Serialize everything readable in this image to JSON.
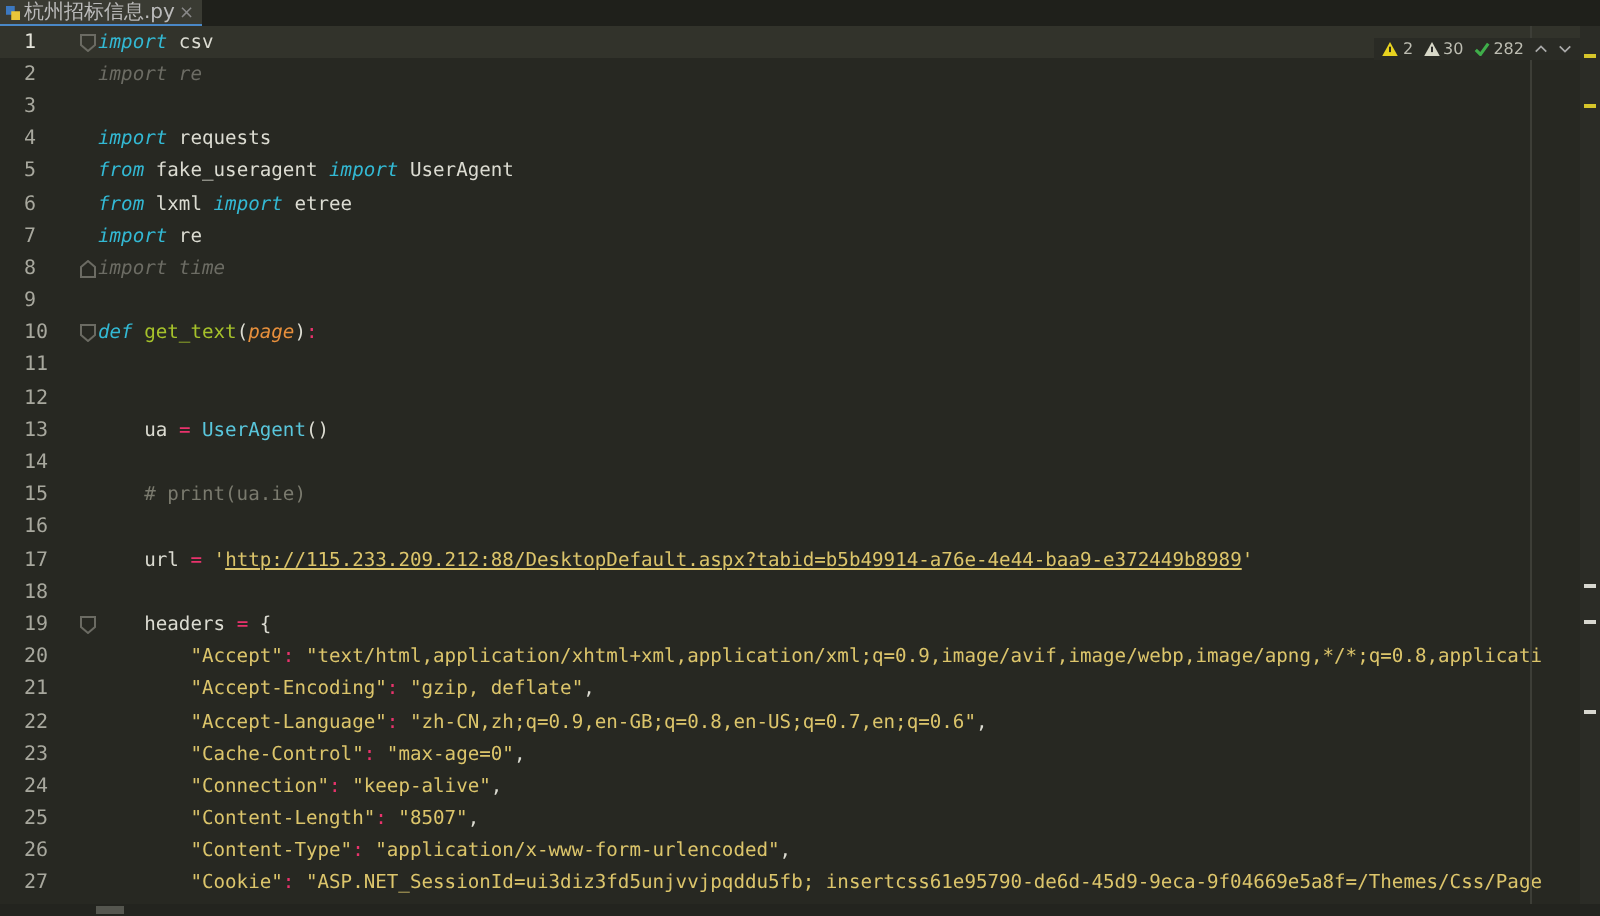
{
  "tab": {
    "title": "杭州招标信息.py",
    "close": "×",
    "selected": true
  },
  "inspections": [
    {
      "kind": "error",
      "count": "2"
    },
    {
      "kind": "warning",
      "count": "30"
    },
    {
      "kind": "typo",
      "count": "282"
    }
  ],
  "lines": [
    {
      "number": "1",
      "current": true,
      "kind": "fold-start",
      "tokens": [
        {
          "kind": "kw",
          "text": "import"
        },
        {
          "kind": "plain",
          "text": " csv"
        }
      ]
    },
    {
      "number": "2",
      "current": false,
      "kind": "code",
      "tokens": [
        {
          "kind": "dim",
          "text": "import re"
        }
      ]
    },
    {
      "number": "3",
      "current": false,
      "kind": "code"
    },
    {
      "number": "4",
      "current": false,
      "kind": "code",
      "tokens": [
        {
          "kind": "kw",
          "text": "import"
        },
        {
          "kind": "plain",
          "text": " requests"
        }
      ]
    },
    {
      "number": "5",
      "current": false,
      "kind": "code",
      "tokens": [
        {
          "kind": "kw",
          "text": "from"
        },
        {
          "kind": "plain",
          "text": " fake_useragent "
        },
        {
          "kind": "kw",
          "text": "import"
        },
        {
          "kind": "plain",
          "text": " UserAgent"
        }
      ]
    },
    {
      "number": "6",
      "current": false,
      "kind": "code",
      "tokens": [
        {
          "kind": "kw",
          "text": "from"
        },
        {
          "kind": "plain",
          "text": " lxml "
        },
        {
          "kind": "kw",
          "text": "import"
        },
        {
          "kind": "plain",
          "text": " etree"
        }
      ]
    },
    {
      "number": "7",
      "current": false,
      "kind": "code",
      "tokens": [
        {
          "kind": "kw",
          "text": "import"
        },
        {
          "kind": "plain",
          "text": " re"
        }
      ]
    },
    {
      "number": "8",
      "current": false,
      "kind": "fold-end",
      "tokens": [
        {
          "kind": "dim",
          "text": "import time"
        }
      ]
    },
    {
      "number": "9",
      "current": false,
      "kind": "code"
    },
    {
      "number": "10",
      "current": false,
      "kind": "fold-start",
      "tokens": [
        {
          "kind": "kw",
          "text": "def"
        },
        {
          "kind": "fn",
          "text": " get_text"
        },
        {
          "kind": "plain",
          "text": "("
        },
        {
          "kind": "param",
          "text": "page"
        },
        {
          "kind": "plain",
          "text": ")"
        },
        {
          "kind": "op",
          "text": ":"
        }
      ]
    },
    {
      "number": "11",
      "current": false,
      "kind": "code"
    },
    {
      "number": "12",
      "current": false,
      "kind": "code"
    },
    {
      "number": "13",
      "current": false,
      "kind": "code",
      "tokens": [
        {
          "kind": "plain",
          "text": "    ua "
        },
        {
          "kind": "op",
          "text": "="
        },
        {
          "kind": "cls",
          "text": " UserAgent"
        },
        {
          "kind": "plain",
          "text": "()"
        }
      ]
    },
    {
      "number": "14",
      "current": false,
      "kind": "code"
    },
    {
      "number": "15",
      "current": false,
      "kind": "code",
      "tokens": [
        {
          "kind": "comment",
          "text": "    # print(ua.ie)"
        }
      ]
    },
    {
      "number": "16",
      "current": false,
      "kind": "code"
    },
    {
      "number": "17",
      "current": false,
      "kind": "code",
      "tokens": [
        {
          "kind": "plain",
          "text": "    url "
        },
        {
          "kind": "op",
          "text": "="
        },
        {
          "kind": "str",
          "text": " '"
        },
        {
          "kind": "url",
          "text": "http://115.233.209.212:88/DesktopDefault.aspx?tabid=b5b49914-a76e-4e44-baa9-e372449b8989"
        },
        {
          "kind": "str",
          "text": "'"
        }
      ]
    },
    {
      "number": "18",
      "current": false,
      "kind": "code"
    },
    {
      "number": "19",
      "current": false,
      "kind": "fold-start",
      "tokens": [
        {
          "kind": "plain",
          "text": "    headers "
        },
        {
          "kind": "op",
          "text": "="
        },
        {
          "kind": "plain",
          "text": " {"
        }
      ]
    },
    {
      "number": "20",
      "current": false,
      "kind": "code",
      "tokens": [
        {
          "kind": "str",
          "text": "        \"Accept\""
        },
        {
          "kind": "op",
          "text": ":"
        },
        {
          "kind": "str",
          "text": " \"text/html,application/xhtml+xml,application/xml;q=0.9,image/avif,image/webp,image/apng,*/*;q=0.8,applicati"
        }
      ]
    },
    {
      "number": "21",
      "current": false,
      "kind": "code",
      "tokens": [
        {
          "kind": "str",
          "text": "        \"Accept-Encoding\""
        },
        {
          "kind": "op",
          "text": ":"
        },
        {
          "kind": "str",
          "text": " \"gzip, deflate\""
        },
        {
          "kind": "plain",
          "text": ","
        }
      ]
    },
    {
      "number": "22",
      "current": false,
      "kind": "code",
      "tokens": [
        {
          "kind": "str",
          "text": "        \"Accept-Language\""
        },
        {
          "kind": "op",
          "text": ":"
        },
        {
          "kind": "str",
          "text": " \"zh-CN,zh;q=0.9,en-GB;q=0.8,en-US;q=0.7,en;q=0.6\""
        },
        {
          "kind": "plain",
          "text": ","
        }
      ]
    },
    {
      "number": "23",
      "current": false,
      "kind": "code",
      "tokens": [
        {
          "kind": "str",
          "text": "        \"Cache-Control\""
        },
        {
          "kind": "op",
          "text": ":"
        },
        {
          "kind": "str",
          "text": " \"max-age=0\""
        },
        {
          "kind": "plain",
          "text": ","
        }
      ]
    },
    {
      "number": "24",
      "current": false,
      "kind": "code",
      "tokens": [
        {
          "kind": "str",
          "text": "        \"Connection\""
        },
        {
          "kind": "op",
          "text": ":"
        },
        {
          "kind": "str",
          "text": " \"keep-alive\""
        },
        {
          "kind": "plain",
          "text": ","
        }
      ]
    },
    {
      "number": "25",
      "current": false,
      "kind": "code",
      "tokens": [
        {
          "kind": "str",
          "text": "        \"Content-Length\""
        },
        {
          "kind": "op",
          "text": ":"
        },
        {
          "kind": "str",
          "text": " \"8507\""
        },
        {
          "kind": "plain",
          "text": ","
        }
      ]
    },
    {
      "number": "26",
      "current": false,
      "kind": "code",
      "tokens": [
        {
          "kind": "str",
          "text": "        \"Content-Type\""
        },
        {
          "kind": "op",
          "text": ":"
        },
        {
          "kind": "str",
          "text": " \"application/x-www-form-urlencoded\""
        },
        {
          "kind": "plain",
          "text": ","
        }
      ]
    },
    {
      "number": "27",
      "current": false,
      "kind": "code",
      "tokens": [
        {
          "kind": "str",
          "text": "        \"Cookie\""
        },
        {
          "kind": "op",
          "text": ":"
        },
        {
          "kind": "str",
          "text": " \"ASP.NET_SessionId=ui3diz3fd5unjvvjpqddu5fb; insertcss61e95790-de6d-45d9-9eca-9f04669e5a8f=/Themes/Css/Page"
        }
      ]
    }
  ]
}
